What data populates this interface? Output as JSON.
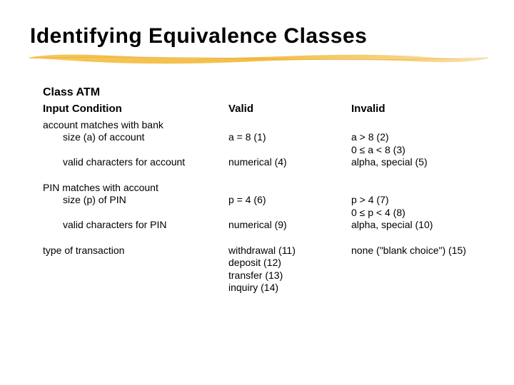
{
  "title": "Identifying Equivalence Classes",
  "class_heading": "Class ATM",
  "headers": {
    "c1": "Input Condition",
    "c2": "Valid",
    "c3": "Invalid"
  },
  "rows": {
    "acct_group": "account matches with bank",
    "acct_size_label": "size (a) of account",
    "acct_size_valid": "a = 8   (1)",
    "acct_size_invalid": "a > 8   (2)\n0 ≤  a < 8   (3)",
    "acct_chars_label": "valid characters for account",
    "acct_chars_valid": "numerical   (4)",
    "acct_chars_invalid": "alpha, special   (5)",
    "pin_group": "PIN matches with account",
    "pin_size_label": "size (p) of PIN",
    "pin_size_valid": "p = 4   (6)",
    "pin_size_invalid": "p > 4   (7)\n0 ≤  p < 4   (8)",
    "pin_chars_label": "valid characters for PIN",
    "pin_chars_valid": "numerical   (9)",
    "pin_chars_invalid": "alpha, special (10)",
    "txn_label": "type of transaction",
    "txn_valid": "withdrawal   (11)\ndeposit   (12)\ntransfer   (13)\ninquiry   (14)",
    "txn_invalid": "none (\"blank choice\")   (15)"
  }
}
